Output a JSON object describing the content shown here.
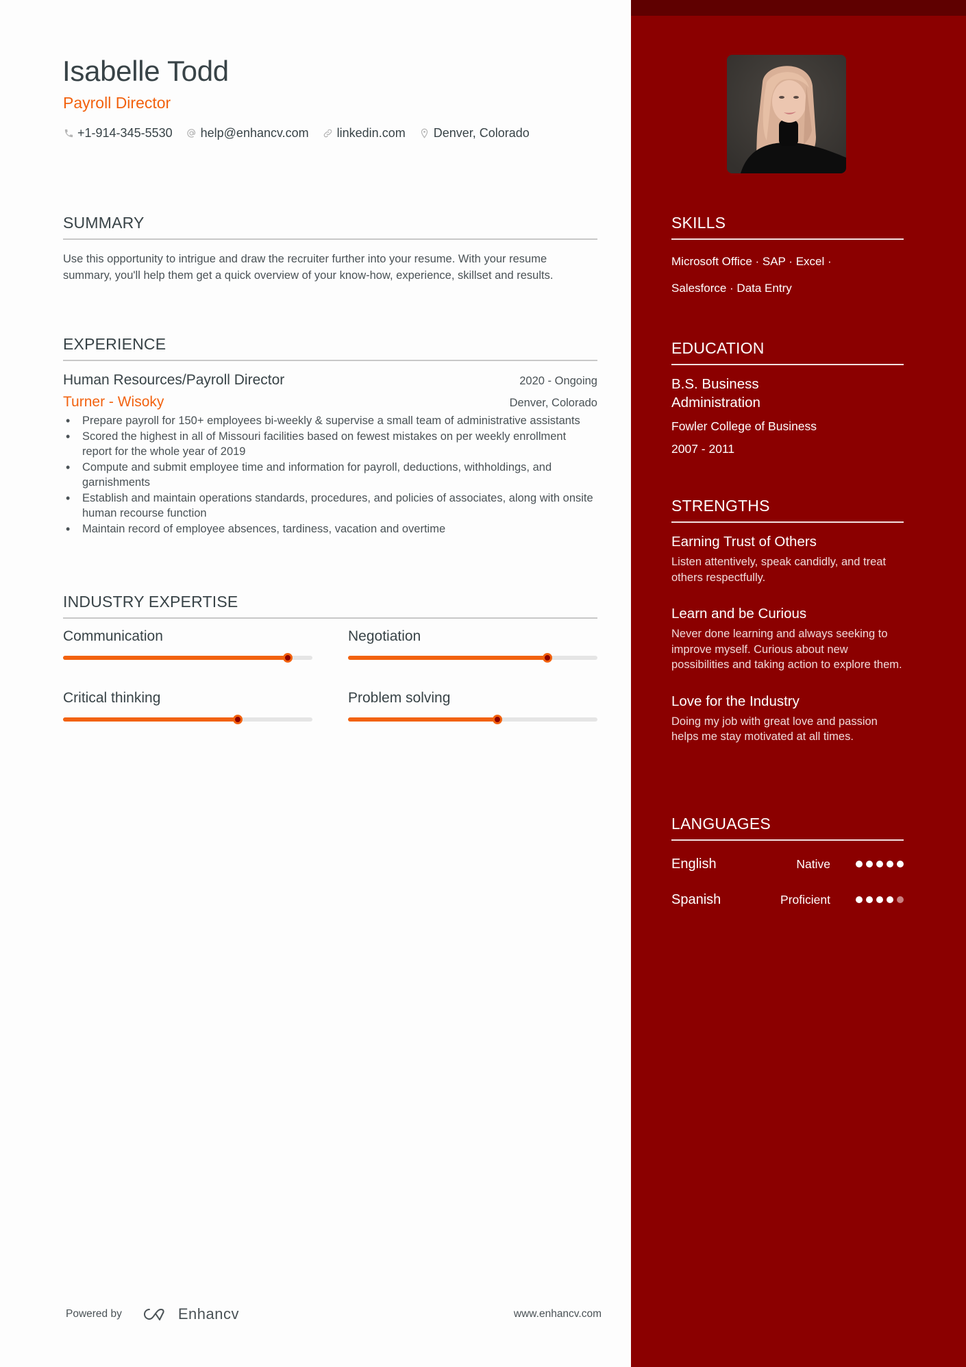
{
  "header": {
    "name": "Isabelle Todd",
    "title": "Payroll Director",
    "contacts": [
      {
        "icon": "phone-icon",
        "text": "+1-914-345-5530"
      },
      {
        "icon": "at-icon",
        "text": "help@enhancv.com"
      },
      {
        "icon": "link-icon",
        "text": "linkedin.com"
      },
      {
        "icon": "location-pin-icon",
        "text": "Denver, Colorado"
      }
    ]
  },
  "summary": {
    "heading": "SUMMARY",
    "text": "Use this opportunity to intrigue and draw the recruiter further into your resume. With your resume summary, you'll help them get a quick overview of your know-how, experience, skillset and results."
  },
  "experience": {
    "heading": "EXPERIENCE",
    "jobs": [
      {
        "title": "Human Resources/Payroll Director",
        "dates": "2020 - Ongoing",
        "company": "Turner - Wisoky",
        "location": "Denver, Colorado",
        "bullets": [
          "Prepare payroll for 150+ employees bi-weekly & supervise a small team of administrative assistants",
          "Scored the highest in all of Missouri facilities based on fewest mistakes on per weekly enrollment report for the whole year of 2019",
          "Compute and submit employee time and information for payroll, deductions, withholdings, and garnishments",
          "Establish and maintain operations standards, procedures, and policies of associates, along with onsite human recourse function",
          "Maintain record of employee absences, tardiness, vacation and overtime"
        ]
      }
    ]
  },
  "expertise": {
    "heading": "INDUSTRY EXPERTISE",
    "items": [
      {
        "label": "Communication",
        "level": 0.9
      },
      {
        "label": "Negotiation",
        "level": 0.8
      },
      {
        "label": "Critical thinking",
        "level": 0.7
      },
      {
        "label": "Problem solving",
        "level": 0.6
      }
    ]
  },
  "footer": {
    "powered_by": "Powered by",
    "brand": "Enhancv",
    "url": "www.enhancv.com"
  },
  "sidebar": {
    "skills": {
      "heading": "SKILLS",
      "line1": "Microsoft Office · SAP · Excel ·",
      "line2": "Salesforce · Data Entry"
    },
    "education": {
      "heading": "EDUCATION",
      "degree_line1": "B.S. Business",
      "degree_line2": "Administration",
      "school": "Fowler College of Business",
      "dates": "2007 - 2011"
    },
    "strengths": {
      "heading": "STRENGTHS",
      "items": [
        {
          "title": "Earning Trust of Others",
          "desc": "Listen attentively, speak candidly, and treat others respectfully."
        },
        {
          "title": "Learn and be Curious",
          "desc": "Never done learning and always seeking to improve myself. Curious about new possibilities and taking action to explore them."
        },
        {
          "title": "Love for the Industry",
          "desc": "Doing my job with great love and passion helps me stay motivated at all times."
        }
      ]
    },
    "languages": {
      "heading": "LANGUAGES",
      "items": [
        {
          "name": "English",
          "level": "Native",
          "dots": 5,
          "max": 5
        },
        {
          "name": "Spanish",
          "level": "Proficient",
          "dots": 4,
          "max": 5
        }
      ]
    }
  },
  "colors": {
    "accent": "#f2620f",
    "sidebar": "#8b0000",
    "sidebar_top": "#5f0000",
    "text": "#384347"
  }
}
